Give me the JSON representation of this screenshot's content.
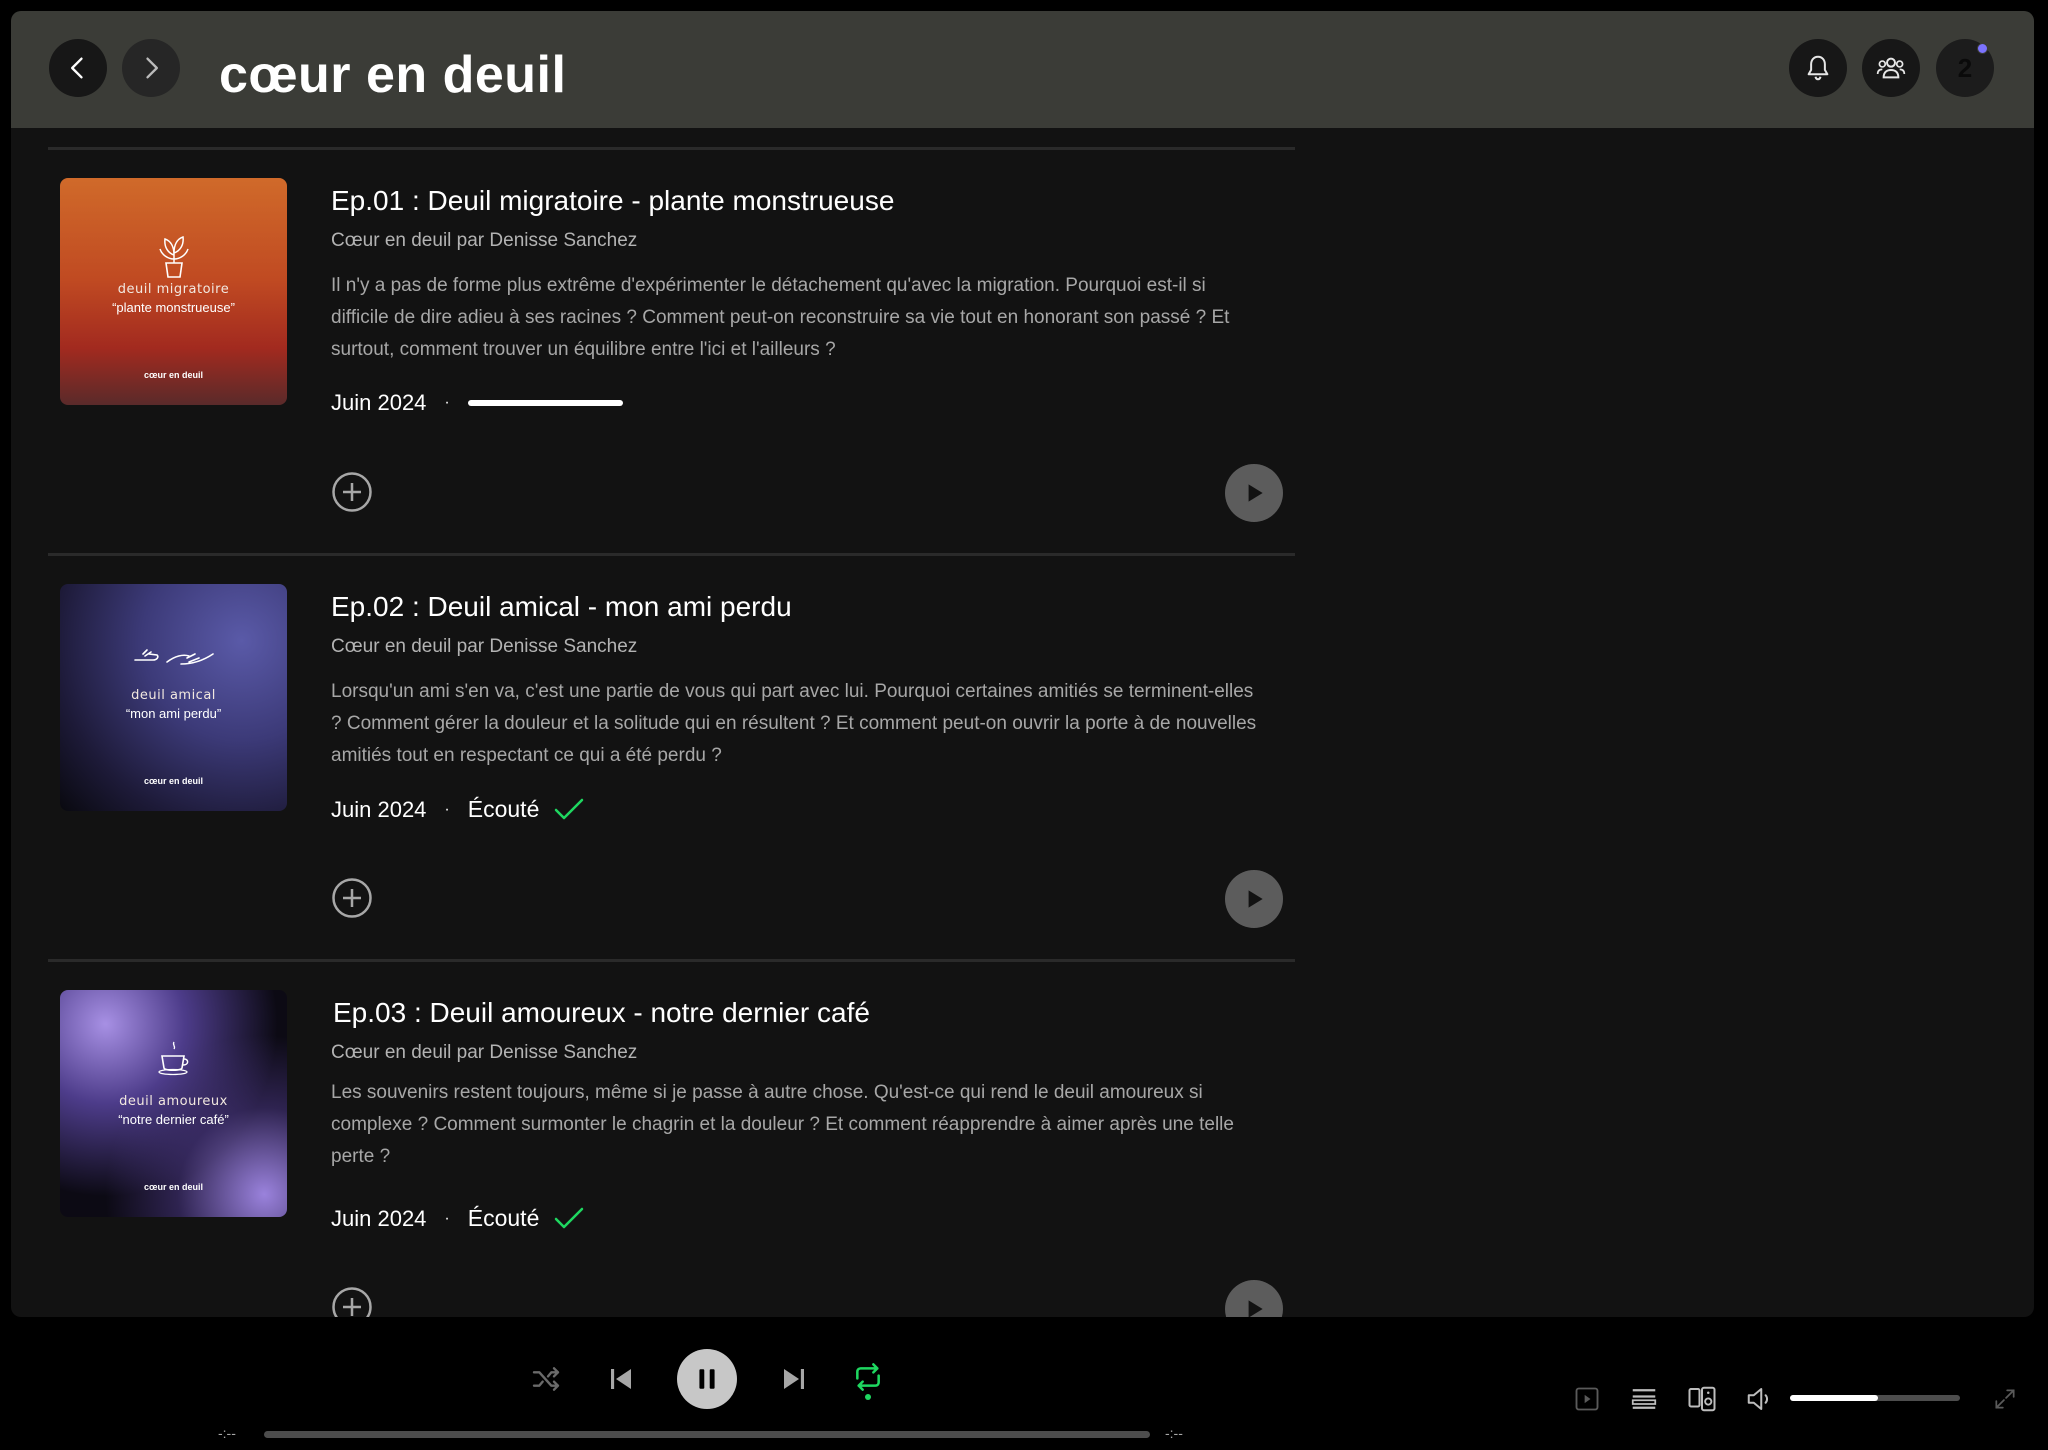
{
  "header": {
    "title": "cœur en deuil",
    "notification_count": "2"
  },
  "episodes": [
    {
      "title": "Ep.01 : Deuil migratoire - plante monstrueuse",
      "subtitle": "Cœur en deuil par Denisse Sanchez",
      "description": "Il n'y a pas de forme plus extrême d'expérimenter le détachement qu'avec la migration. Pourquoi est-il si difficile de dire adieu à ses racines ? Comment peut-on reconstruire sa vie tout en honorant son passé ? Et surtout, comment trouver un équilibre entre l'ici et l'ailleurs ?",
      "date": "Juin 2024",
      "cover_line1": "deuil migratoire",
      "cover_line2": "“plante monstrueuse”",
      "cover_logo": "cœur en deuil",
      "progress": 0.95
    },
    {
      "title": "Ep.02 : Deuil amical - mon ami perdu",
      "subtitle": "Cœur en deuil par Denisse Sanchez",
      "description": "Lorsqu'un ami s'en va, c'est une partie de vous qui part avec lui. Pourquoi certaines amitiés se terminent-elles ? Comment gérer la douleur et la solitude qui en résultent ? Et comment peut-on ouvrir la porte à de nouvelles amitiés tout en respectant ce qui a été perdu ?",
      "date": "Juin 2024",
      "status": "Écouté",
      "cover_line1": "deuil amical",
      "cover_line2": "“mon ami perdu”",
      "cover_logo": "cœur en deuil"
    },
    {
      "title": "Ep.03 : Deuil amoureux - notre dernier café",
      "subtitle": "Cœur en deuil par Denisse Sanchez",
      "description": "Les souvenirs restent toujours, même si je passe à autre chose. Qu'est-ce qui rend le deuil amoureux si complexe ? Comment surmonter le chagrin et la douleur ? Et comment réapprendre à aimer après une telle perte ?",
      "date": "Juin 2024",
      "status": "Écouté",
      "cover_line1": "deuil amoureux",
      "cover_line2": "“notre dernier café”",
      "cover_logo": "cœur en deuil"
    }
  ],
  "meta_separator": "·",
  "player": {
    "elapsed": "-:--",
    "remaining": "-:--",
    "volume": 0.52,
    "repeat_active_color": "#1ed760"
  },
  "colors": {
    "accent": "#1ed760",
    "topbar": "#3b3c37",
    "background": "#121212"
  }
}
